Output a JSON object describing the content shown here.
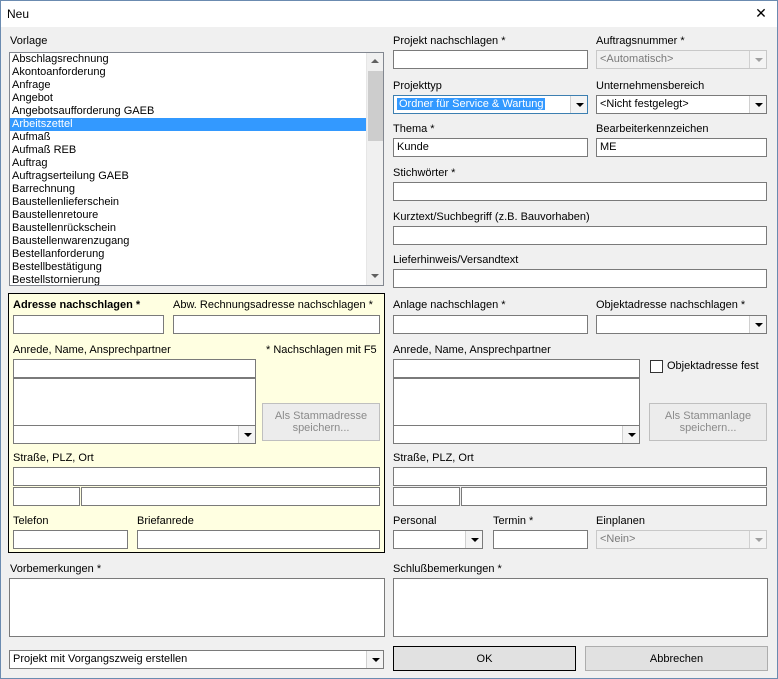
{
  "window": {
    "title": "Neu",
    "close_glyph": "✕"
  },
  "template": {
    "label": "Vorlage",
    "items": [
      "Abschlagsrechnung",
      "Akontoanforderung",
      "Anfrage",
      "Angebot",
      "Angebotsaufforderung GAEB",
      "Arbeitszettel",
      "Aufmaß",
      "Aufmaß REB",
      "Auftrag",
      "Auftragserteilung GAEB",
      "Barrechnung",
      "Baustellenlieferschein",
      "Baustellenretoure",
      "Baustellenrückschein",
      "Baustellenwarenzugang",
      "Bestellanforderung",
      "Bestellbestätigung",
      "Bestellstornierung"
    ],
    "selected": "Arbeitszettel"
  },
  "project": {
    "lookup_label": "Projekt nachschlagen *",
    "lookup_value": "",
    "order_number_label": "Auftragsnummer *",
    "order_number_value": "<Automatisch>",
    "type_label": "Projekttyp",
    "type_value": "Ordner für Service & Wartung",
    "business_area_label": "Unternehmensbereich",
    "business_area_value": "<Nicht festgelegt>",
    "subject_label": "Thema *",
    "subject_value": "Kunde",
    "editor_label": "Bearbeiterkennzeichen",
    "editor_value": "ME",
    "keywords_label": "Stichwörter *",
    "keywords_value": "",
    "shorttext_label": "Kurztext/Suchbegriff (z.B. Bauvorhaben)",
    "shorttext_value": "",
    "delivery_label": "Lieferhinweis/Versandtext",
    "delivery_value": ""
  },
  "address": {
    "lookup_label": "Adresse nachschlagen *",
    "invoice_lookup_label": "Abw. Rechnungsadresse nachschlagen *",
    "salutation_label": "Anrede, Name, Ansprechpartner",
    "f5_hint": "* Nachschlagen mit F5",
    "save_master_button": "Als Stammadresse speichern...",
    "street_label": "Straße, PLZ, Ort",
    "phone_label": "Telefon",
    "letter_salutation_label": "Briefanrede"
  },
  "site": {
    "lookup_label": "Anlage nachschlagen *",
    "object_lookup_label": "Objektadresse nachschlagen *",
    "salutation_label": "Anrede, Name, Ansprechpartner",
    "fixed_label": "Objektadresse fest",
    "save_master_button": "Als Stammanlage speichern...",
    "street_label": "Straße, PLZ, Ort",
    "personnel_label": "Personal",
    "date_label": "Termin *",
    "schedule_label": "Einplanen",
    "schedule_value": "<Nein>"
  },
  "remarks": {
    "pre_label": "Vorbemerkungen *",
    "post_label": "Schlußbemerkungen *"
  },
  "footer": {
    "mode_value": "Projekt mit Vorgangszweig erstellen",
    "ok_label": "OK",
    "cancel_label": "Abbrechen"
  },
  "colors": {
    "selection": "#3399ff",
    "address_panel": "#ffffe1",
    "dialog_bg": "#f0f0f0"
  }
}
